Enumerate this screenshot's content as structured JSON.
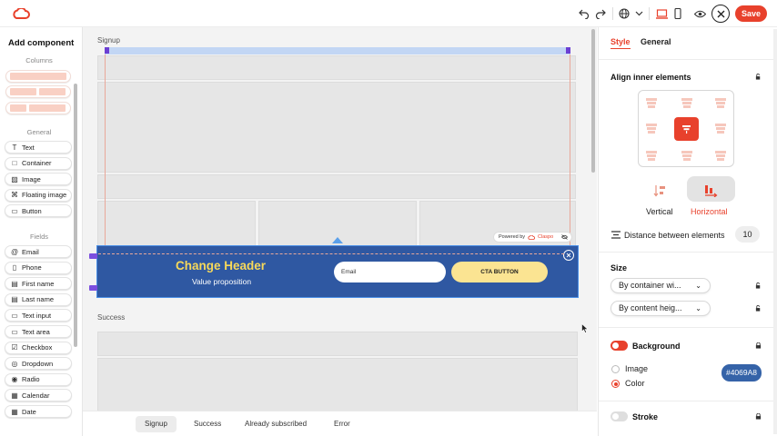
{
  "colors": {
    "brand": "#E8412C",
    "banner": "#2F58A2",
    "ctaYellow": "#FBE492",
    "headerYellow": "#F7D95A",
    "selection": "#4A8FE7"
  },
  "topbar": {
    "save_label": "Save",
    "icons": [
      "cloud-logo-icon",
      "undo-icon",
      "redo-icon",
      "globe-icon",
      "chevron-down-icon",
      "desktop-icon",
      "mobile-icon",
      "eye-icon",
      "close-icon"
    ]
  },
  "left": {
    "title": "Add component",
    "columns_label": "Columns",
    "general_label": "General",
    "general": [
      {
        "label": "Text",
        "icon": "T"
      },
      {
        "label": "Container",
        "icon": "□"
      },
      {
        "label": "Image",
        "icon": "▨"
      },
      {
        "label": "Floating image",
        "icon": "⌘"
      },
      {
        "label": "Button",
        "icon": "▭"
      }
    ],
    "fields_label": "Fields",
    "fields": [
      {
        "label": "Email",
        "icon": "@"
      },
      {
        "label": "Phone",
        "icon": "▯"
      },
      {
        "label": "First name",
        "icon": "▤"
      },
      {
        "label": "Last name",
        "icon": "▤"
      },
      {
        "label": "Text input",
        "icon": "▭"
      },
      {
        "label": "Text area",
        "icon": "▭"
      },
      {
        "label": "Checkbox",
        "icon": "☑"
      },
      {
        "label": "Dropdown",
        "icon": "◎"
      },
      {
        "label": "Radio",
        "icon": "◉"
      },
      {
        "label": "Calendar",
        "icon": "▦"
      },
      {
        "label": "Date",
        "icon": "▦"
      }
    ]
  },
  "canvas": {
    "signup_label": "Signup",
    "success_label": "Success",
    "powered_by": "Powered by",
    "powered_brand": "Claspo",
    "banner": {
      "header": "Change Header",
      "subheader": "Value proposition",
      "email_placeholder": "Email",
      "cta": "CTA BUTTON"
    }
  },
  "bottom_tabs": [
    {
      "label": "Signup",
      "active": true
    },
    {
      "label": "Success",
      "active": false
    },
    {
      "label": "Already subscribed",
      "active": false
    },
    {
      "label": "Error",
      "active": false
    }
  ],
  "right": {
    "tabs": [
      {
        "label": "Style",
        "active": true
      },
      {
        "label": "General",
        "active": false
      }
    ],
    "align_title": "Align inner elements",
    "vertical_label": "Vertical",
    "horizontal_label": "Horizontal",
    "distance_label": "Distance between elements",
    "distance_value": "10",
    "size_title": "Size",
    "size_width": "By container wi...",
    "size_height": "By content heig...",
    "background_label": "Background",
    "background_on": true,
    "bg_image_label": "Image",
    "bg_color_label": "Color",
    "bg_color_value": "#4069A8",
    "stroke_label": "Stroke",
    "stroke_on": false
  }
}
